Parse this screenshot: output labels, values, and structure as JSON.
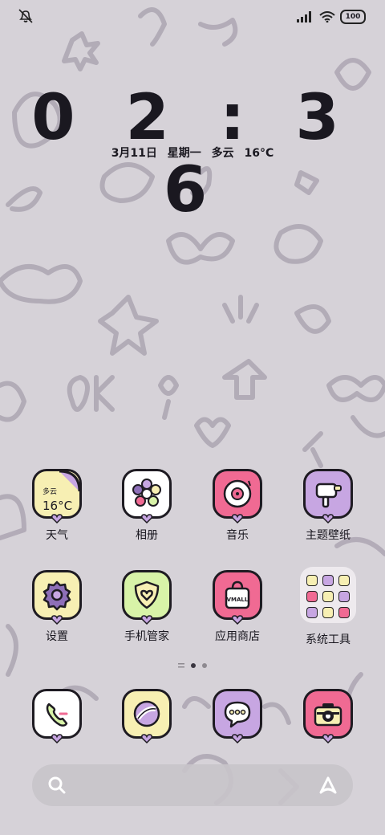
{
  "status_bar": {
    "battery": "100",
    "icons": [
      "mute-icon",
      "signal-icon",
      "wifi-icon",
      "battery-icon"
    ]
  },
  "clock": {
    "time": "0 2 : 3 6",
    "date": "3月11日",
    "weekday": "星期一",
    "weather": "多云",
    "temperature": "16°C"
  },
  "weather_widget": {
    "condition": "多云",
    "temperature": "16°C"
  },
  "apps": [
    {
      "label": "天气",
      "icon": "weather-icon",
      "color": "#f7efb3"
    },
    {
      "label": "相册",
      "icon": "flower-icon",
      "color": "#ffffff"
    },
    {
      "label": "音乐",
      "icon": "record-icon",
      "color": "#f06a93"
    },
    {
      "label": "主题壁纸",
      "icon": "brush-icon",
      "color": "#c7a6e2"
    },
    {
      "label": "设置",
      "icon": "gear-icon",
      "color": "#f7efb3"
    },
    {
      "label": "手机管家",
      "icon": "shield-heart-icon",
      "color": "#d8f3a8"
    },
    {
      "label": "应用商店",
      "icon": "shopping-bag-icon",
      "color": "#f06a93"
    },
    {
      "label": "系统工具",
      "icon": "folder-icon",
      "color": "#f2eef3"
    }
  ],
  "store_bag_text": "VMALL",
  "dock": [
    {
      "icon": "phone-icon",
      "color": "#ffffff"
    },
    {
      "icon": "browser-icon",
      "color": "#f7efb3"
    },
    {
      "icon": "message-icon",
      "color": "#c7a6e2"
    },
    {
      "icon": "camera-icon",
      "color": "#f06a93"
    }
  ],
  "page_indicator": {
    "pages": 2,
    "current": 1
  }
}
